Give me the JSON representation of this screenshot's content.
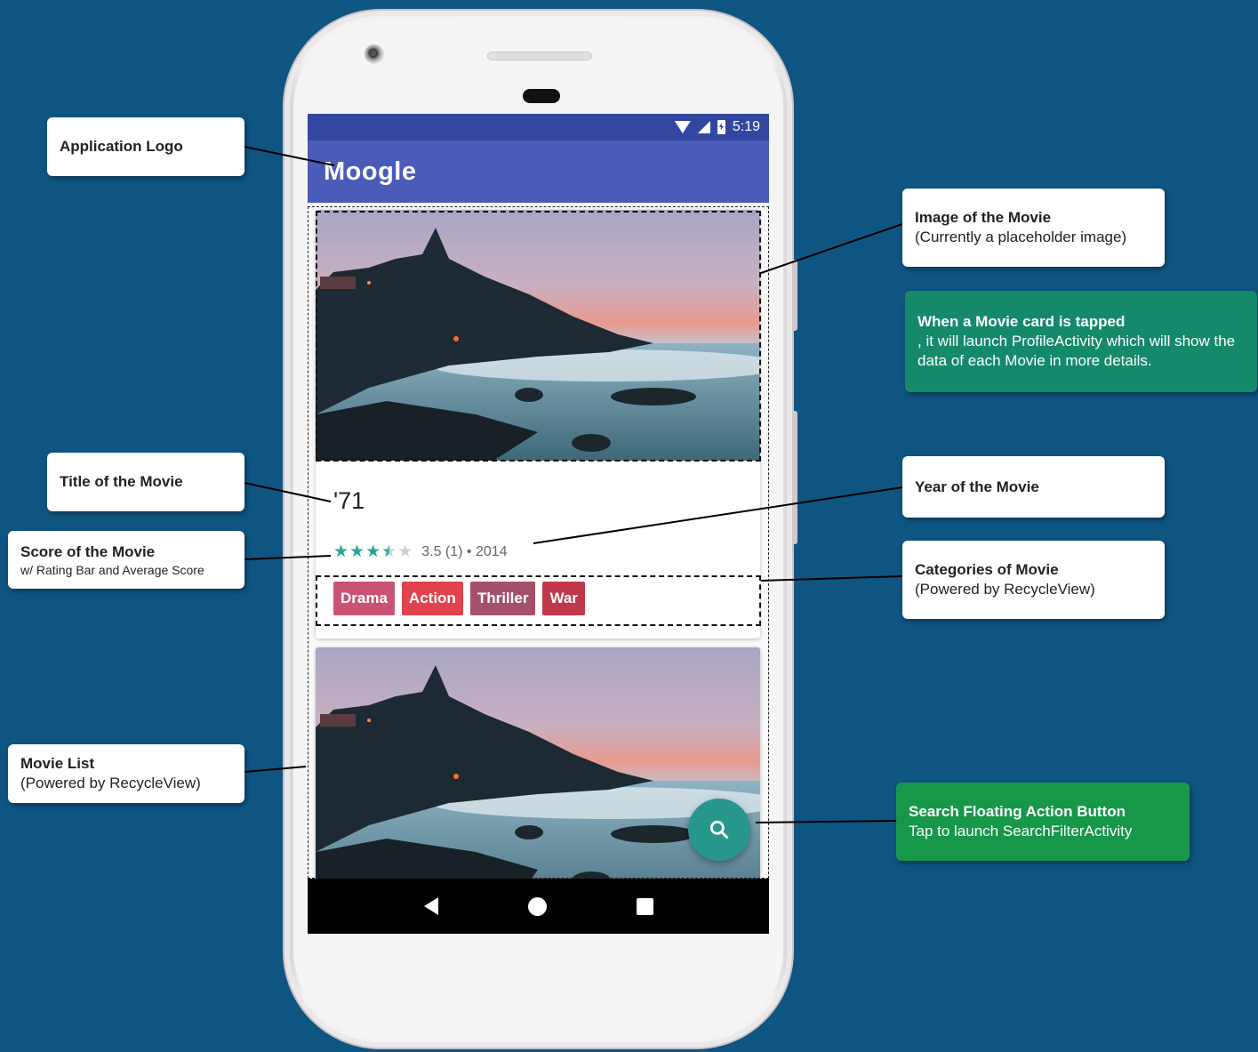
{
  "app": {
    "status_time": "5:19",
    "logo": "Moogle",
    "app_bar_color": "#4a5cb8",
    "status_bar_color": "#3447a0"
  },
  "movie_card": {
    "title": "'71",
    "rating": 3.5,
    "rating_max": 5,
    "rating_text": "3.5 (1) • 2014",
    "categories": [
      {
        "label": "Drama",
        "color": "#c95375"
      },
      {
        "label": "Action",
        "color": "#e0424e"
      },
      {
        "label": "Thriller",
        "color": "#a5506a"
      },
      {
        "label": "War",
        "color": "#c0394a"
      }
    ]
  },
  "fab": {
    "icon": "search-icon",
    "color": "#26978a"
  },
  "nav": {
    "back": "back-icon",
    "home": "home-icon",
    "recent": "recent-apps-icon"
  },
  "callouts": {
    "logo": {
      "title": "Application Logo"
    },
    "image": {
      "title": "Image of the Movie",
      "sub": "(Currently a placeholder image)"
    },
    "tap": {
      "title": "When a Movie card is tapped",
      "sub": ", it will launch ProfileActivity which will show the data of each Movie in more details."
    },
    "title": {
      "title": "Title of the Movie"
    },
    "year": {
      "title": "Year of the Movie"
    },
    "score": {
      "title": "Score of the Movie",
      "sub": "w/ Rating Bar and Average Score"
    },
    "categories": {
      "title": "Categories of Movie",
      "sub": "(Powered by RecycleView)"
    },
    "list": {
      "title": "Movie List",
      "sub": "(Powered by RecycleView)"
    },
    "fab": {
      "title": "Search Floating Action Button",
      "sub": "Tap to launch SearchFilterActivity"
    }
  },
  "colors": {
    "background": "#0f5582",
    "tap_callout": "#148a6b",
    "fab_callout": "#17974a"
  }
}
